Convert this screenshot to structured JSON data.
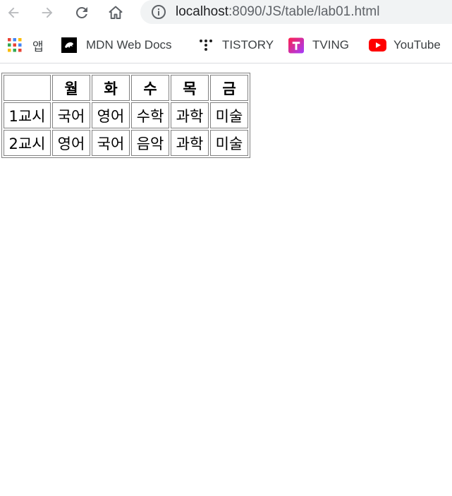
{
  "browser": {
    "url_host": "localhost",
    "url_rest": ":8090/JS/table/lab01.html"
  },
  "bookmarks": [
    {
      "label": "앱",
      "icon": "apps-grid-icon"
    },
    {
      "label": "MDN Web Docs",
      "icon": "mdn-icon"
    },
    {
      "label": "TISTORY",
      "icon": "tistory-icon"
    },
    {
      "label": "TVING",
      "icon": "tving-icon"
    },
    {
      "label": "YouTube",
      "icon": "youtube-icon"
    }
  ],
  "table": {
    "header": [
      "",
      "월",
      "화",
      "수",
      "목",
      "금"
    ],
    "rows": [
      [
        "1교시",
        "국어",
        "영어",
        "수학",
        "과학",
        "미술"
      ],
      [
        "2교시",
        "영어",
        "국어",
        "음악",
        "과학",
        "미술"
      ]
    ]
  },
  "colors": {
    "youtube": "#ff0000",
    "tving_gradient": [
      "#ff1f4b",
      "#a23cff"
    ],
    "omnibox": "#f1f3f4"
  }
}
